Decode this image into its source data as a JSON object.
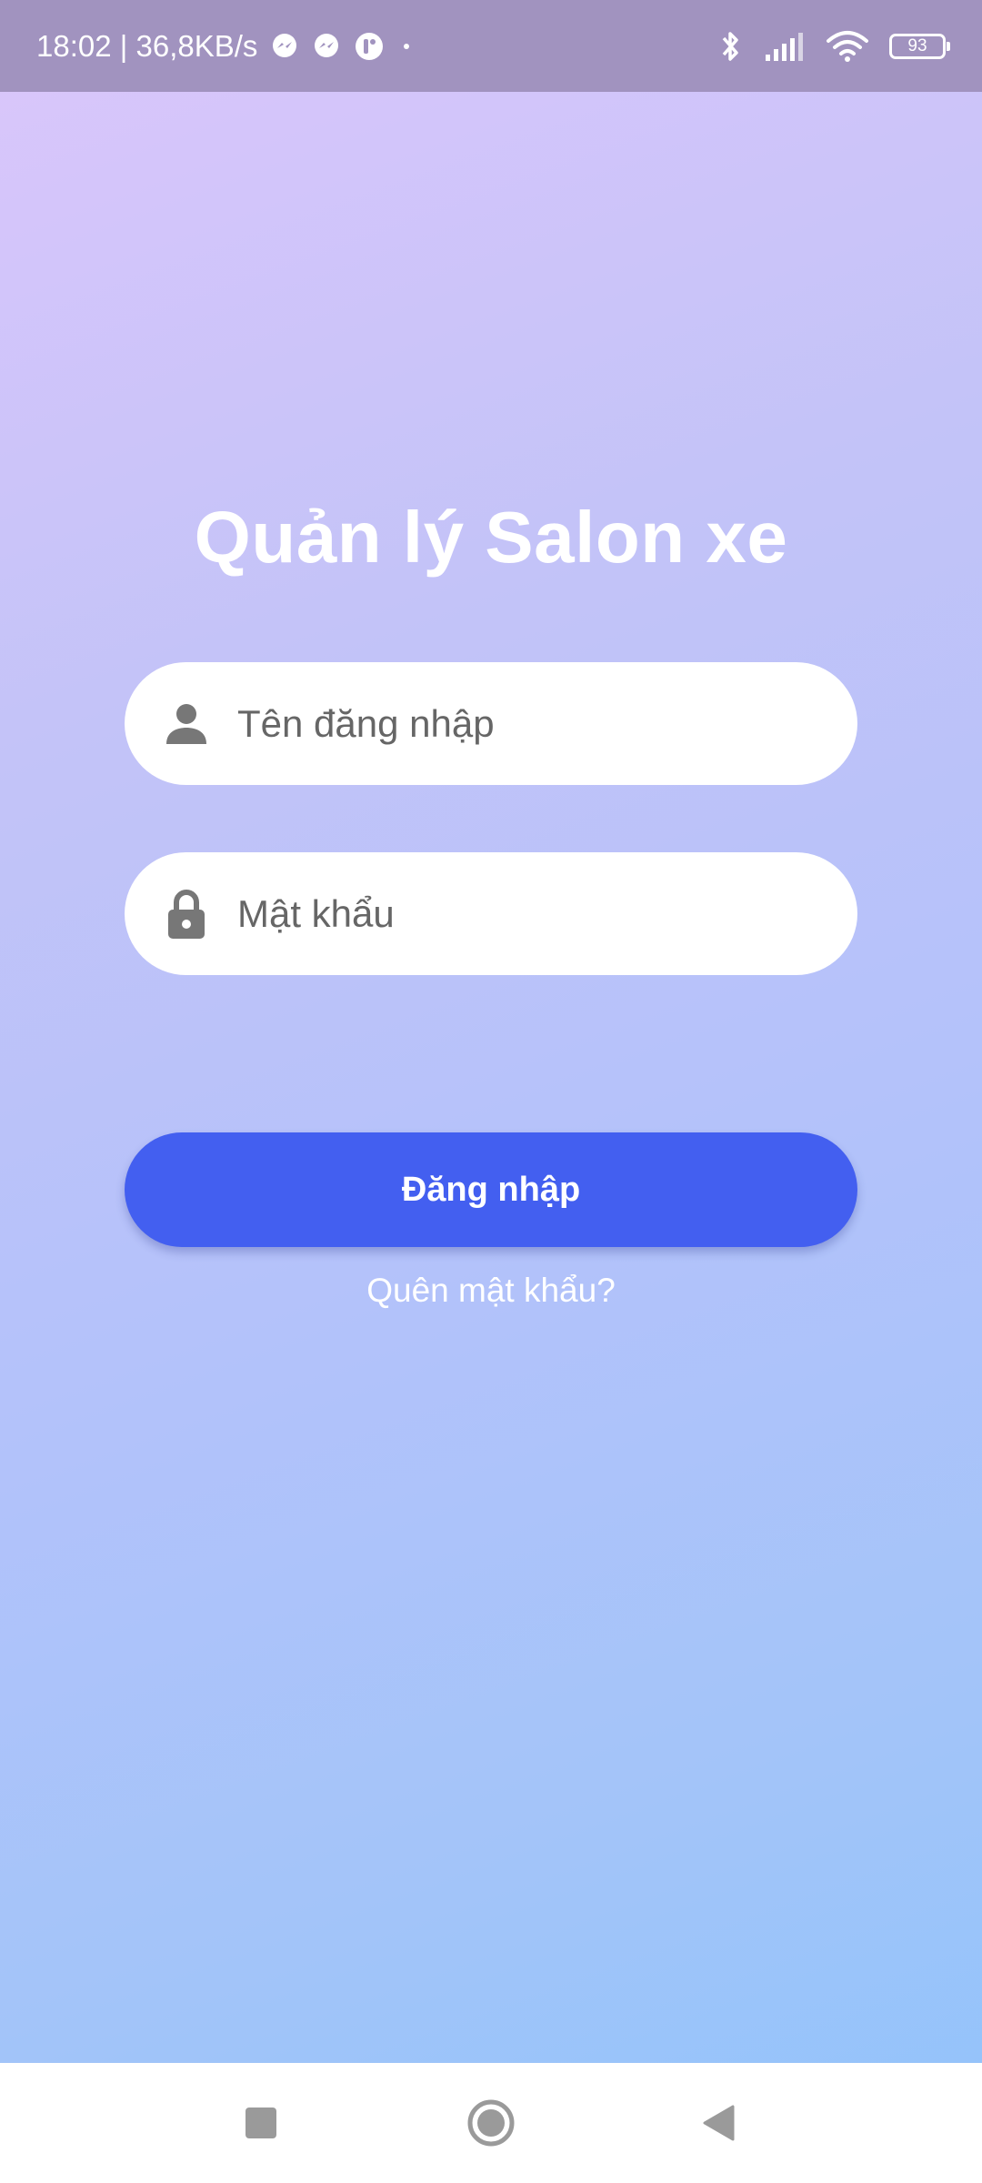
{
  "status_bar": {
    "time_speed": "18:02 | 36,8KB/s",
    "notification_icons": [
      "messenger-icon",
      "messenger-icon",
      "app-icon",
      "dot-icon"
    ],
    "system_icons": [
      "bluetooth-icon",
      "signal-icon",
      "wifi-icon",
      "battery-icon"
    ],
    "battery_level": "93"
  },
  "login": {
    "title": "Quản lý Salon xe",
    "username_placeholder": "Tên đăng nhập",
    "password_placeholder": "Mật khẩu",
    "login_button": "Đăng nhập",
    "forgot_password": "Quên mật khẩu?"
  },
  "nav_bar": {
    "buttons": [
      "recents-icon",
      "home-icon",
      "back-icon"
    ]
  },
  "colors": {
    "primary_button": "#435ff0",
    "status_bar": "#a193bf",
    "gradient_top": "#dbc6fb",
    "gradient_bottom": "#91c3fa"
  }
}
